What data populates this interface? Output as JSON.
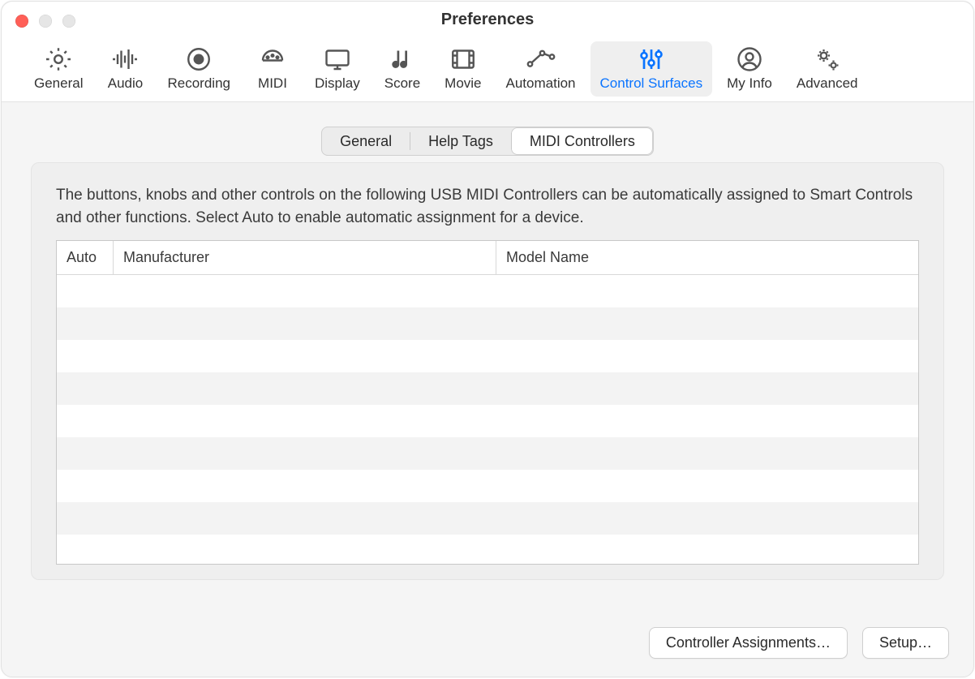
{
  "window": {
    "title": "Preferences"
  },
  "toolbar": {
    "items": [
      {
        "key": "general",
        "label": "General"
      },
      {
        "key": "audio",
        "label": "Audio"
      },
      {
        "key": "recording",
        "label": "Recording"
      },
      {
        "key": "midi",
        "label": "MIDI"
      },
      {
        "key": "display",
        "label": "Display"
      },
      {
        "key": "score",
        "label": "Score"
      },
      {
        "key": "movie",
        "label": "Movie"
      },
      {
        "key": "automation",
        "label": "Automation"
      },
      {
        "key": "control",
        "label": "Control Surfaces",
        "active": true
      },
      {
        "key": "myinfo",
        "label": "My Info"
      },
      {
        "key": "advanced",
        "label": "Advanced"
      }
    ]
  },
  "tabs": {
    "items": [
      {
        "label": "General"
      },
      {
        "label": "Help Tags"
      },
      {
        "label": "MIDI Controllers",
        "selected": true
      }
    ]
  },
  "description": "The buttons, knobs and other controls on the following USB MIDI Controllers can be automatically assigned to Smart Controls and other functions. Select Auto to enable automatic assignment for a device.",
  "table": {
    "columns": {
      "auto": "Auto",
      "manufacturer": "Manufacturer",
      "model": "Model Name"
    },
    "rows": []
  },
  "buttons": {
    "controller_assignments": "Controller Assignments…",
    "setup": "Setup…"
  }
}
